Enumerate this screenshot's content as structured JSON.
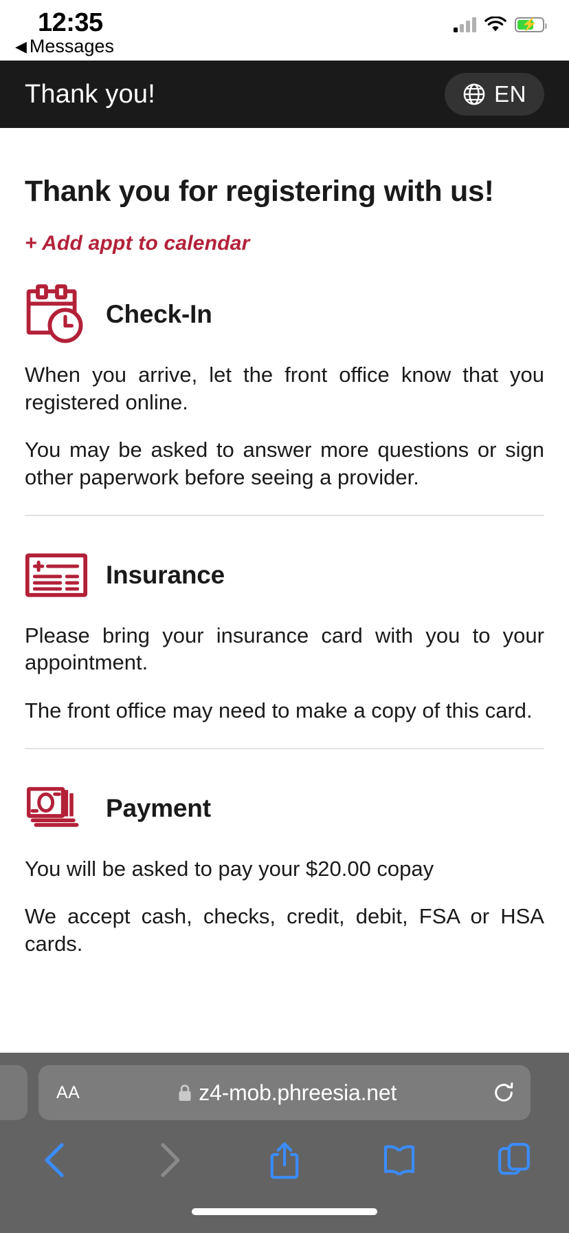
{
  "status_bar": {
    "time": "12:35",
    "back_label": "Messages",
    "back_arrow": "◀",
    "icons": {
      "cellular": "cellular-signal-icon",
      "wifi": "wifi-icon",
      "battery": "battery-charging-icon"
    }
  },
  "header": {
    "title": "Thank you!",
    "language_code": "EN",
    "globe_icon": "globe-icon"
  },
  "main": {
    "heading": "Thank you for registering with us!",
    "calendar_link": "+ Add appt to calendar",
    "sections": [
      {
        "id": "check-in",
        "icon": "calendar-clock-icon",
        "title": "Check-In",
        "paragraphs": [
          "When you arrive, let the front office know that you registered online.",
          "You may be asked to answer more questions or sign other paperwork before seeing a provider."
        ]
      },
      {
        "id": "insurance",
        "icon": "insurance-card-icon",
        "title": "Insurance",
        "paragraphs": [
          "Please bring your insurance card with you to your appointment.",
          "The front office may need to make a copy of this card."
        ]
      },
      {
        "id": "payment",
        "icon": "money-stack-icon",
        "title": "Payment",
        "paragraphs": [
          "You will be asked to pay your $20.00 copay",
          "We accept cash, checks, credit, debit, FSA or HSA cards."
        ]
      }
    ]
  },
  "browser": {
    "text_size_label": "AA",
    "url": "z4-mob.phreesia.net",
    "lock_icon": "lock-icon",
    "reload_icon": "reload-icon",
    "toolbar": [
      {
        "name": "back-button",
        "icon": "chevron-left-icon",
        "enabled": true
      },
      {
        "name": "forward-button",
        "icon": "chevron-right-icon",
        "enabled": false
      },
      {
        "name": "share-button",
        "icon": "share-icon",
        "enabled": true
      },
      {
        "name": "bookmarks-button",
        "icon": "book-icon",
        "enabled": true
      },
      {
        "name": "tabs-button",
        "icon": "tabs-icon",
        "enabled": true
      }
    ]
  },
  "colors": {
    "brand_red": "#b32139",
    "header_bg": "#1a1a1a",
    "safari_bg": "#636363",
    "safari_blue": "#3b8cff",
    "divider": "#dfe3e6"
  }
}
